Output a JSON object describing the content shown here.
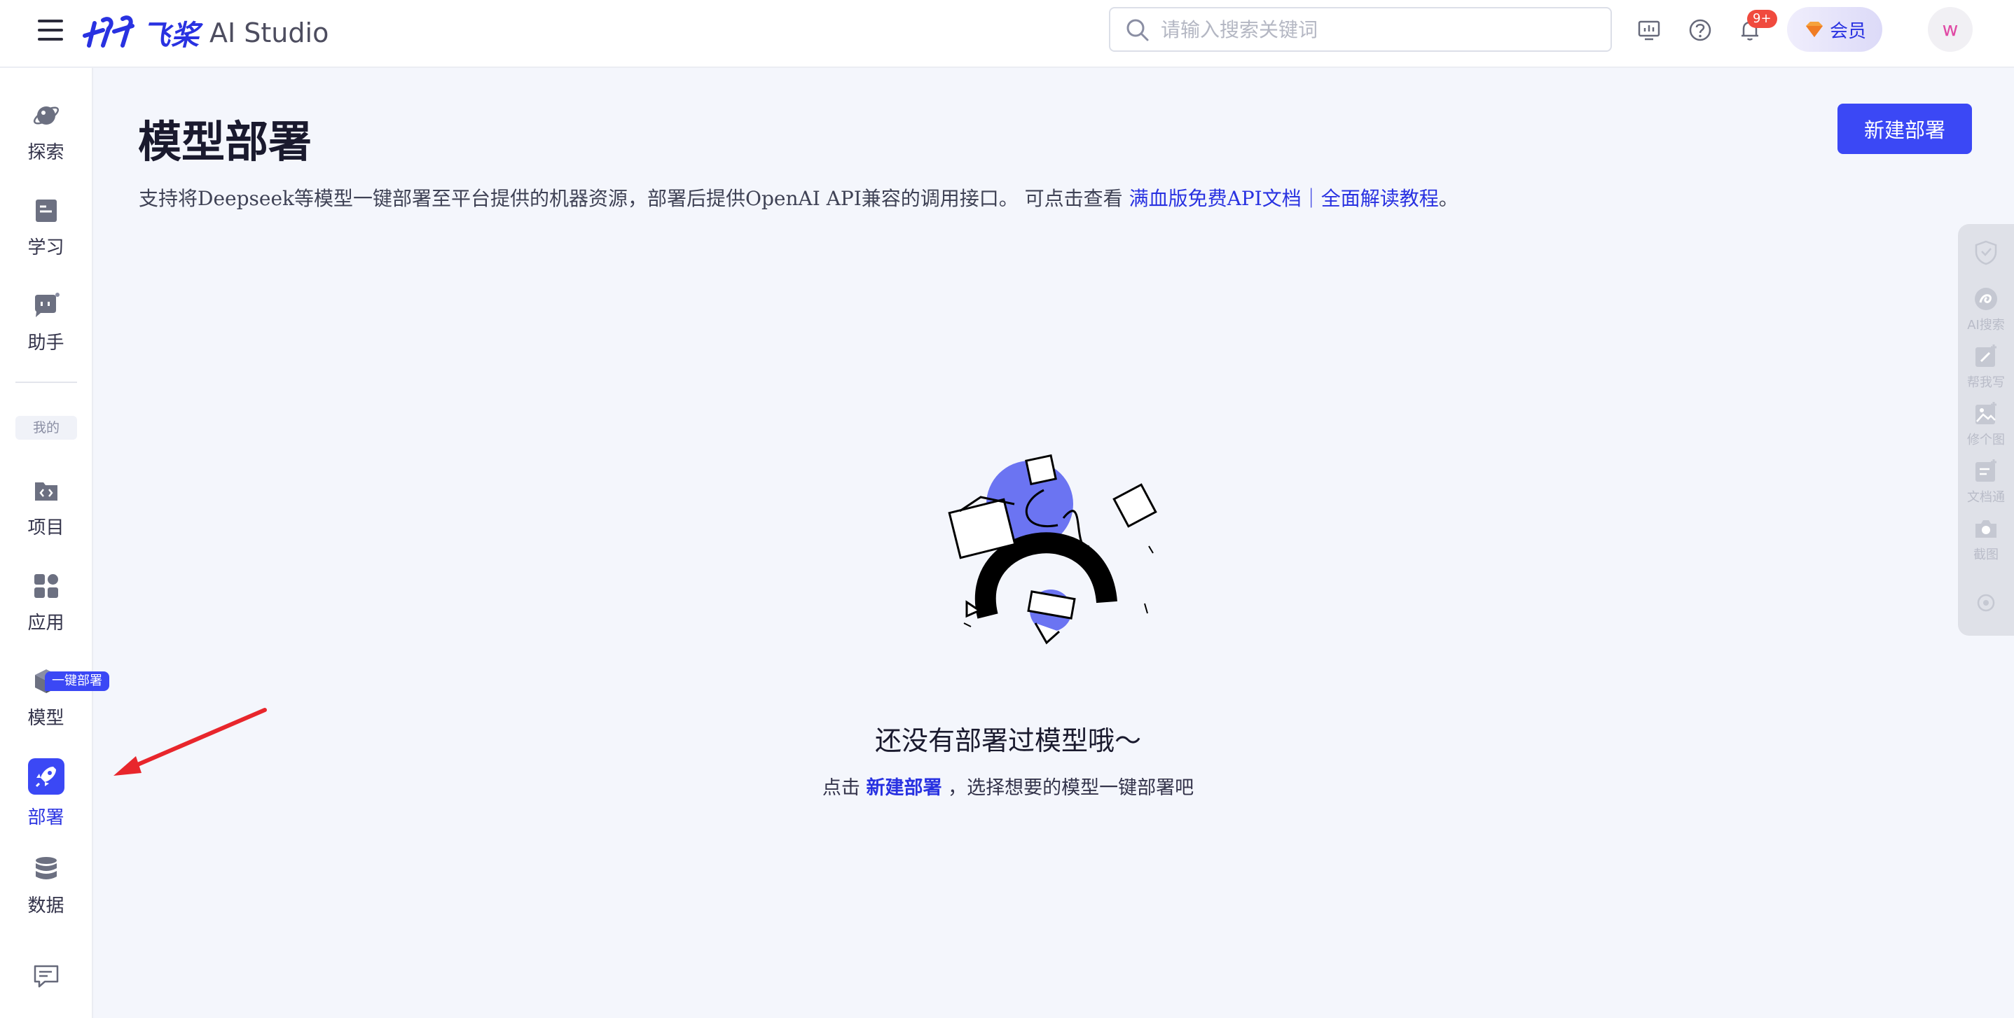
{
  "header": {
    "brand_cn": "飞桨",
    "brand_en": "AI Studio",
    "search_placeholder": "请输入搜索关键词",
    "notification_badge": "9+",
    "vip_label": "会员",
    "avatar_initial": "w"
  },
  "sidebar": {
    "items_top": [
      {
        "label": "探索",
        "icon": "planet-icon"
      },
      {
        "label": "学习",
        "icon": "book-icon"
      },
      {
        "label": "助手",
        "icon": "chat-bot-icon"
      }
    ],
    "mine_label": "我的",
    "items_mine": [
      {
        "label": "项目",
        "icon": "code-folder-icon"
      },
      {
        "label": "应用",
        "icon": "apps-grid-icon"
      },
      {
        "label": "模型",
        "icon": "cube-icon"
      },
      {
        "label": "部署",
        "icon": "rocket-icon"
      },
      {
        "label": "数据",
        "icon": "database-icon"
      }
    ],
    "deploy_tag": "一键部署",
    "active_item": "部署"
  },
  "main": {
    "title": "模型部署",
    "description": "支持将Deepseek等模型一键部署至平台提供的机器资源，部署后提供OpenAI API兼容的调用接口。 可点击查看 ",
    "desc_link": "满血版免费API文档｜全面解读教程",
    "desc_end": "。",
    "new_button": "新建部署",
    "empty_title": "还没有部署过模型哦～",
    "empty_prefix": "点击 ",
    "empty_link": "新建部署",
    "empty_suffix": " ，选择想要的模型一键部署吧"
  },
  "right_toolbar": [
    {
      "label": "",
      "icon": "shield-heart-icon"
    },
    {
      "label": "AI搜索",
      "icon": "ai-search-icon"
    },
    {
      "label": "帮我写",
      "icon": "write-icon"
    },
    {
      "label": "修个图",
      "icon": "image-edit-icon"
    },
    {
      "label": "文档通",
      "icon": "document-icon"
    },
    {
      "label": "截图",
      "icon": "camera-icon"
    },
    {
      "label": "",
      "icon": "settings-icon"
    }
  ],
  "colors": {
    "accent": "#3b48f5",
    "brand": "#2932e1",
    "background": "#f4f6fc",
    "badge": "#f04a3e",
    "annotation_arrow": "#e8262c"
  }
}
